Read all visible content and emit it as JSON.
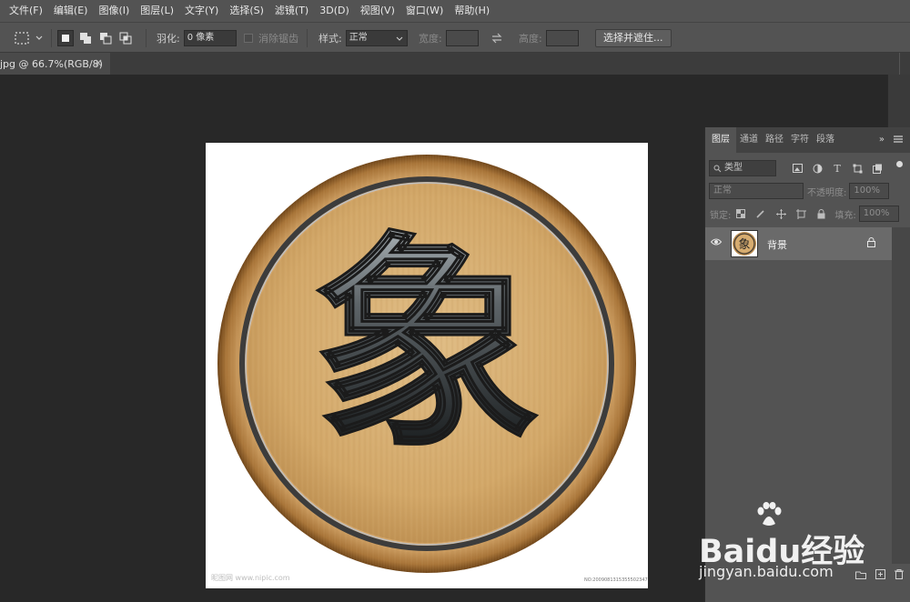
{
  "menubar": {
    "items": [
      "文件(F)",
      "编辑(E)",
      "图像(I)",
      "图层(L)",
      "文字(Y)",
      "选择(S)",
      "滤镜(T)",
      "3D(D)",
      "视图(V)",
      "窗口(W)",
      "帮助(H)"
    ]
  },
  "options": {
    "feather_label": "羽化:",
    "feather_value": "0 像素",
    "antialias_label": "消除锯齿",
    "style_label": "样式:",
    "style_value": "正常",
    "width_label": "宽度:",
    "height_label": "高度:",
    "select_mask_button": "选择并遮住..."
  },
  "document": {
    "tab_label": "jpg @ 66.7%(RGB/8)",
    "close_glyph": "×"
  },
  "artwork": {
    "character": "象",
    "credit": "昵图网 www.nipic.com",
    "credit_user": "BY: jiangyang...",
    "image_id": "NO:20090813153555023474"
  },
  "layers_panel": {
    "tabs": [
      "图层",
      "通道",
      "路径",
      "字符",
      "段落"
    ],
    "active_tab": "图层",
    "more_glyph": "»",
    "filter_kind": "类型",
    "blend_mode": "正常",
    "opacity_label": "不透明度:",
    "opacity_value": "100%",
    "lock_label": "锁定:",
    "fill_label": "填充:",
    "fill_value": "100%",
    "layers": [
      {
        "name": "背景",
        "visible": true,
        "locked": true
      }
    ]
  },
  "watermark": {
    "brand": "Baidu经验",
    "url": "jingyan.baidu.com"
  },
  "colors": {
    "ui_panel": "#535353",
    "canvas_bg": "#282828",
    "wood": "#c89a5e",
    "wood_dark": "#8a5a2b"
  }
}
